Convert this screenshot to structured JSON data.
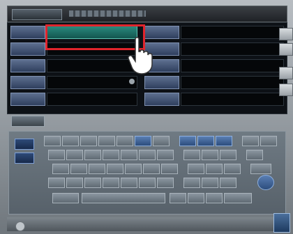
{
  "screen": {
    "accent_color": "#1f7a70",
    "highlight_color": "#e0242c"
  },
  "panel": {
    "selected_field": "patient-name-field",
    "fields_left_count": 5,
    "fields_right_count": 5
  },
  "pointer": {
    "icon": "hand-pointer-icon"
  },
  "keyboard": {
    "rows": 5
  }
}
